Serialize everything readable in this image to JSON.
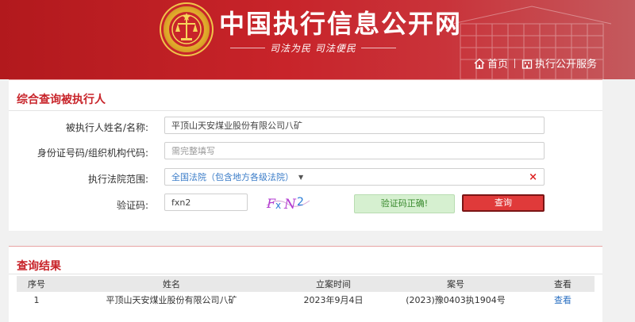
{
  "header": {
    "site_title": "中国执行信息公开网",
    "slogan": "司法为民  司法便民",
    "nav": [
      {
        "label": "首页",
        "icon": "home-icon"
      },
      {
        "label": "执行公开服务",
        "icon": "building-icon"
      }
    ]
  },
  "search_form": {
    "title": "综合查询被执行人",
    "fields": {
      "name": {
        "label": "被执行人姓名/名称:",
        "value": "平顶山天安煤业股份有限公司八矿"
      },
      "id_number": {
        "label": "身份证号码/组织机构代码:",
        "placeholder": "需完整填写"
      },
      "court": {
        "label": "执行法院范围:",
        "value": "全国法院（包含地方各级法院）",
        "clear": "×"
      },
      "captcha": {
        "label": "验证码:",
        "value": "fxn2",
        "image_text": "FxN2"
      }
    },
    "verify_status": "验证码正确!",
    "submit_label": "查询"
  },
  "results": {
    "title": "查询结果",
    "columns": [
      "序号",
      "姓名",
      "立案时间",
      "案号",
      "查看"
    ],
    "rows": [
      {
        "index": "1",
        "name": "平顶山天安煤业股份有限公司八矿",
        "date": "2023年9月4日",
        "case_no": "(2023)豫0403执1904号",
        "action": "查看"
      }
    ]
  },
  "colors": {
    "brand_red": "#c8242a",
    "link_blue": "#2a6fc2",
    "success_green": "#3a8a2e"
  }
}
